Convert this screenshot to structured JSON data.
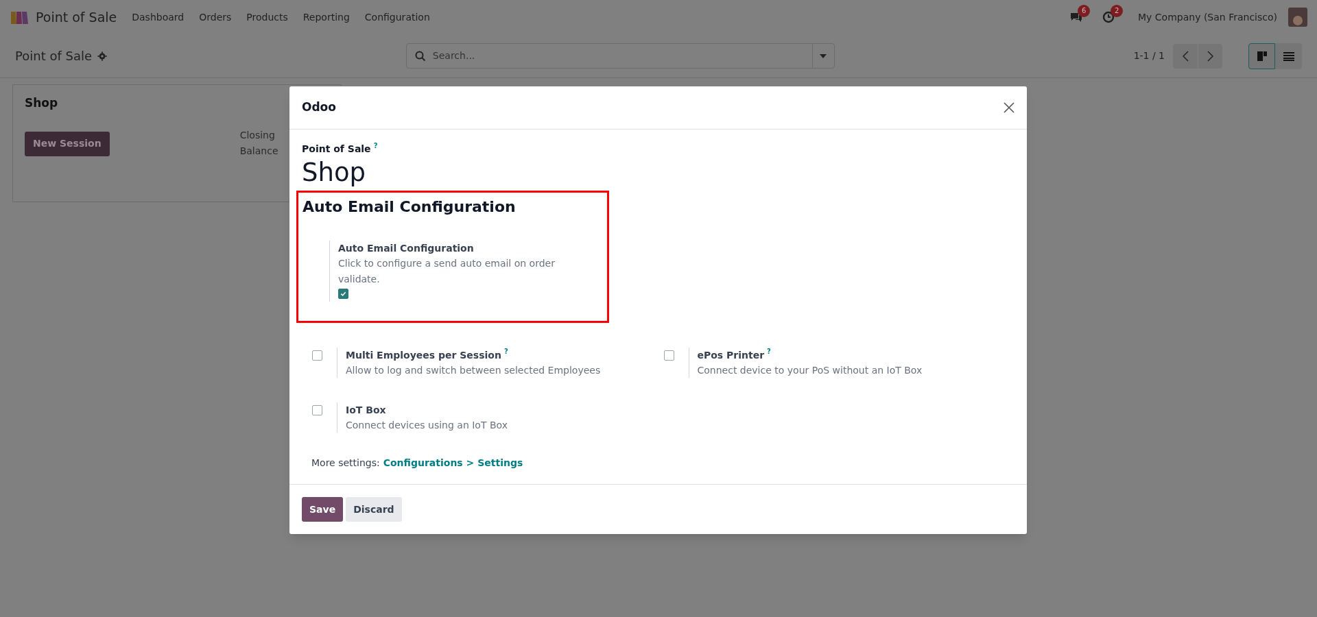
{
  "navbar": {
    "app_name": "Point of Sale",
    "menu": [
      "Dashboard",
      "Orders",
      "Products",
      "Reporting",
      "Configuration"
    ],
    "messages_count": "6",
    "activities_count": "2",
    "company": "My Company (San Francisco)"
  },
  "control_panel": {
    "title": "Point of Sale",
    "search": {
      "placeholder": "Search..."
    },
    "pager": "1-1 / 1",
    "views": [
      {
        "kind": "kanban",
        "selected": true
      },
      {
        "kind": "list",
        "selected": false
      }
    ]
  },
  "card": {
    "title": "Shop",
    "button": "New Session",
    "label_lines": [
      "Closing",
      "Balance"
    ]
  },
  "dialog": {
    "title": "Odoo",
    "field_label": "Point of Sale",
    "field_help": "?",
    "name": "Shop",
    "highlighted_section": {
      "heading": "Auto Email Configuration",
      "setting": {
        "title": "Auto Email Configuration",
        "description": "Click to configure a send auto email on order validate.",
        "checked": true
      }
    },
    "settings": [
      {
        "title": "Multi Employees per Session",
        "help": "?",
        "description": "Allow to log and switch between selected Employees",
        "checked": false
      },
      {
        "title": "ePos Printer",
        "help": "?",
        "description": "Connect device to your PoS without an IoT Box",
        "checked": false
      },
      {
        "title": "IoT Box",
        "description": "Connect devices using an IoT Box",
        "checked": false
      }
    ],
    "more_settings": {
      "text": "More settings:",
      "link": "Configurations > Settings"
    },
    "buttons": [
      {
        "kind": "primary",
        "label": "Save"
      },
      {
        "kind": "secondary",
        "label": "Discard"
      }
    ]
  }
}
